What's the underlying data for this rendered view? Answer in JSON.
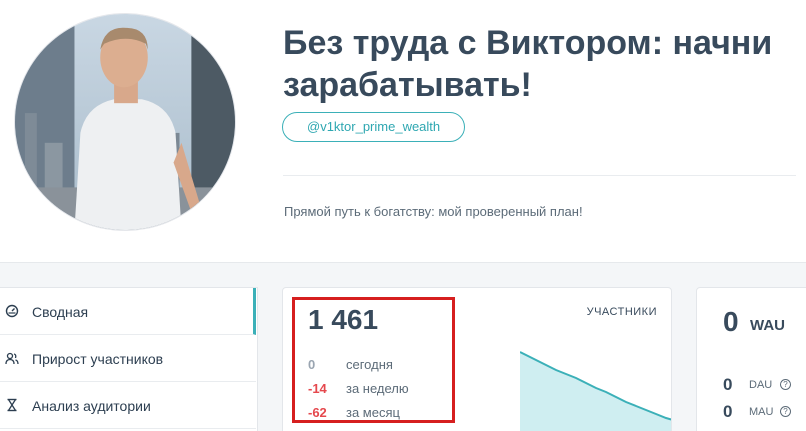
{
  "header": {
    "title": "Без труда с Виктором: начни зарабатывать!",
    "handle": "@v1ktor_prime_wealth",
    "description": "Прямой путь к богатству: мой проверенный план!"
  },
  "sidebar": {
    "items": [
      {
        "label": "Сводная",
        "icon": "dashboard-icon"
      },
      {
        "label": "Прирост участников",
        "icon": "users-icon"
      },
      {
        "label": "Анализ аудитории",
        "icon": "hourglass-icon"
      }
    ]
  },
  "members": {
    "total": "1 461",
    "label": "УЧАСТНИКИ",
    "stats": [
      {
        "value": "0",
        "text": "сегодня"
      },
      {
        "value": "-14",
        "text": "за неделю"
      },
      {
        "value": "-62",
        "text": "за месяц"
      }
    ]
  },
  "activity": {
    "wau_value": "0",
    "wau_label": "WAU",
    "dau_value": "0",
    "dau_label": "DAU",
    "mau_value": "0",
    "mau_label": "MAU",
    "help_glyph": "?"
  },
  "colors": {
    "accent": "#3bb0b8",
    "negative": "#e5484d",
    "highlight": "#d61f1f"
  }
}
